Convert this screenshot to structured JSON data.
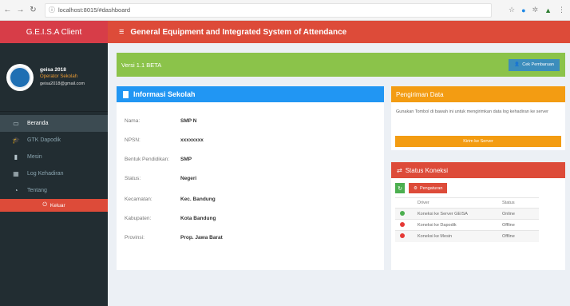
{
  "browser": {
    "url": "localhost:8015/#dashboard"
  },
  "sidebar": {
    "brand": "G.E.I.S.A Client",
    "user": {
      "name": "geisa 2018",
      "role": "Operator Sekolah",
      "email": "geisa2018@gmail.com"
    },
    "items": [
      {
        "label": "Beranda",
        "icon": "monitor-icon",
        "glyph": "▭"
      },
      {
        "label": "GTK Dapodik",
        "icon": "graduation-cap-icon",
        "glyph": "🎓"
      },
      {
        "label": "Mesin",
        "icon": "device-icon",
        "glyph": "▮"
      },
      {
        "label": "Log Kehadiran",
        "icon": "log-icon",
        "glyph": "▦"
      },
      {
        "label": "Tentang",
        "icon": "about-icon",
        "glyph": "◔"
      }
    ],
    "logout": "Keluar"
  },
  "header": {
    "title": "General Equipment and Integrated System of Attendance"
  },
  "version": {
    "label": "Versi 1.1 BETA",
    "update_button": "Cek Pembaruan"
  },
  "info": {
    "title": "Informasi Sekolah",
    "rows": [
      {
        "label": "Nama:",
        "value": "SMP N"
      },
      {
        "label": "NPSN:",
        "value": "xxxxxxxx"
      },
      {
        "label": "Bentuk Pendidikan:",
        "value": "SMP"
      },
      {
        "label": "Status:",
        "value": "Negeri"
      },
      {
        "label": "Kecamatan:",
        "value": "Kec. Bandung"
      },
      {
        "label": "Kabupaten:",
        "value": "Kota Bandung"
      },
      {
        "label": "Provinsi:",
        "value": "Prop. Jawa Barat"
      }
    ]
  },
  "kirim": {
    "title": "Pengiriman Data",
    "description": "Gunakan Tombol di bawah ini untuk mengirimkan data log kehadiran ke server",
    "button": "Kirim ke Server"
  },
  "status": {
    "title": "Status Koneksi",
    "settings_button": "Pengaturan",
    "columns": [
      "Driver",
      "Status"
    ],
    "rows": [
      {
        "driver": "Koneksi ke Server GEISA",
        "status": "Online",
        "color": "#4caf50"
      },
      {
        "driver": "Koneksi ke Dapodik",
        "status": "Offline",
        "color": "#e53935"
      },
      {
        "driver": "Koneksi ke Mesin",
        "status": "Offline",
        "color": "#e53935"
      }
    ]
  },
  "colors": {
    "red": "#dd4b39",
    "green": "#8bc34a",
    "blue": "#2196f3",
    "orange": "#f39c12",
    "sidebar": "#222d32"
  }
}
